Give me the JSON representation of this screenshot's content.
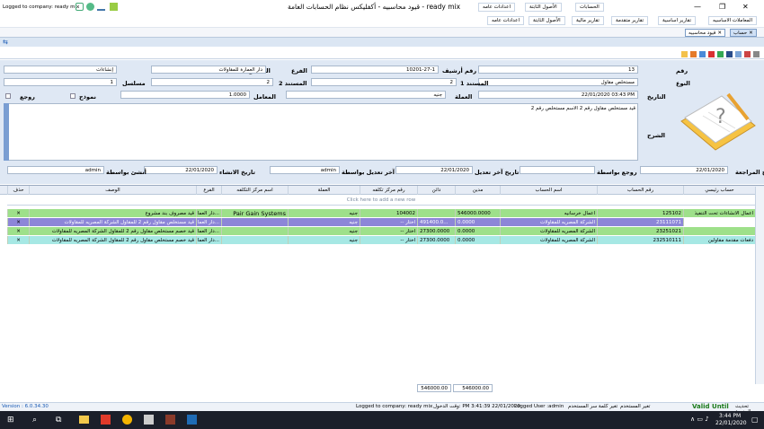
{
  "title": {
    "company_label": "Logged to company: ready mix",
    "window_title": "قيود محاسبيه - أكفليكس نظام الحسابات العامة - ready mix"
  },
  "ribbon": {
    "tabs": [
      "الحسابات",
      "الأصول الثابتة",
      "اعدادات عامه"
    ],
    "groups": [
      "المعاملات الاساسيه",
      "تقارير اساسية",
      "تقارير متقدمة",
      "تقارير مالية",
      "الأصول الثابتة",
      "اعدادات عامه"
    ]
  },
  "doc_tabs": {
    "tab1": "حساب",
    "tab2": "قيود محاسبيه"
  },
  "form": {
    "number_label": "رقم",
    "number_value": "13",
    "archive_label": "رقم أرشيف",
    "archive_value": "10201-27-1",
    "app_label": "التطبيق",
    "app_value": "إنشاءات",
    "type_label": "النوع",
    "type_value": "مستخلص مقاول",
    "branch_label": "الفرع",
    "branch_value": "دار العمارة للمقاولات",
    "doc1_label": "المستند 1",
    "doc1_value": "2",
    "doc2_label": "المستند 2",
    "doc2_value": "2",
    "serial_label": "مسلسل",
    "serial_value": "1",
    "date_label": "التاريخ",
    "date_value": "22/01/2020 03:43 PM",
    "currency_label": "العملة",
    "currency_value": "جنيه",
    "rate_label": "المعامل",
    "rate_value": "1.0000",
    "template_label": "نموذج",
    "reverse_label": "روجع",
    "desc_label": "الشرح",
    "desc_value": "قيد مستخلص مقاول رقم 2 الاسم مستخلص رقم 2",
    "review_date_label": "تاريخ المراجعة",
    "review_date_value": "22/01/2020",
    "reviewed_by_label": "روجع بواسطة",
    "reviewed_by_value": "",
    "edit_date_label": "تاريخ آخر تعديل",
    "edit_date_value": "22/01/2020",
    "edited_by_label": "آخر تعديل بواسطة",
    "edited_by_value": "admin",
    "created_date_label": "تاريخ الانشاء",
    "created_date_value": "22/01/2020",
    "created_by_label": "أنشئ بواسطة",
    "created_by_value": "admin"
  },
  "grid": {
    "headers": [
      "حساب رئيسي",
      "رقم الحساب",
      "اسم الحساب",
      "مدين",
      "دائن",
      "رقم مركز تكلفه",
      "العملة",
      "اسم مركز التكلفه",
      "الفرع",
      "الوصف",
      "حذف"
    ],
    "new_row_hint": "Click here to add a new row",
    "rows": [
      {
        "main": "اعمال الانشاءات تحت التنفيذ",
        "acc": "125102",
        "name": "اعمال خرسانيه",
        "debit": "546000.0000",
        "credit": "",
        "cc": "104002",
        "cur": "جنيه",
        "ccname": "Pair Gain Systems",
        "branch": "دار العما...",
        "desc": "قيد مصروف بند مشروع",
        "del": "✕",
        "bg": "#9ee08a"
      },
      {
        "main": "",
        "acc": "23111071",
        "name": "الشركة المصريه للمقاولات",
        "debit": "0.0000",
        "credit": "491400.0...",
        "cc": "-- اختار",
        "cur": "جنيه",
        "ccname": "",
        "branch": "دار العما...",
        "desc": "قيد مستخلص مقاول رقم 2 للمقاول الشركة المصريه للمقاولات",
        "del": "✕",
        "bg": "#8d86d8"
      },
      {
        "main": "",
        "acc": "23251021",
        "name": "الشركة المصريه للمقاولات",
        "debit": "0.0000",
        "credit": "27300.0000",
        "cc": "-- اختار",
        "cur": "جنيه",
        "ccname": "",
        "branch": "دار العما...",
        "desc": "قيد خصم مستخلص مقاول رقم 2 للمقاول الشركة المصريه للمقاولات",
        "del": "✕",
        "bg": "#9ee08a"
      },
      {
        "main": "دفعات مقدمة مقاولين",
        "acc": "232510111",
        "name": "الشركة المصريه للمقاولات",
        "debit": "0.0000",
        "credit": "27300.0000",
        "cc": "-- اختار",
        "cur": "جنيه",
        "ccname": "",
        "branch": "دار العما...",
        "desc": "قيد خصم مستخلص مقاول رقم 2 للمقاول الشركة المصريه للمقاولات",
        "del": "✕",
        "bg": "#a6e8e4"
      }
    ],
    "total_debit": "546000.00",
    "total_credit": "546000.00"
  },
  "status": {
    "version": "Version : 6.0.34.30",
    "company": "Logged to company: ready mix",
    "time": "وقت الدخول: PM 3:41:39 22/01/2020",
    "user": "Logged User :admin",
    "change_pass": "تغير كلمة سر المستخدم",
    "change_user": "تغير المستخدم",
    "valid": "Valid Until",
    "license": "تحديث الرخصة"
  },
  "taskbar": {
    "time": "3:44 PM",
    "date": "22/01/2020"
  }
}
